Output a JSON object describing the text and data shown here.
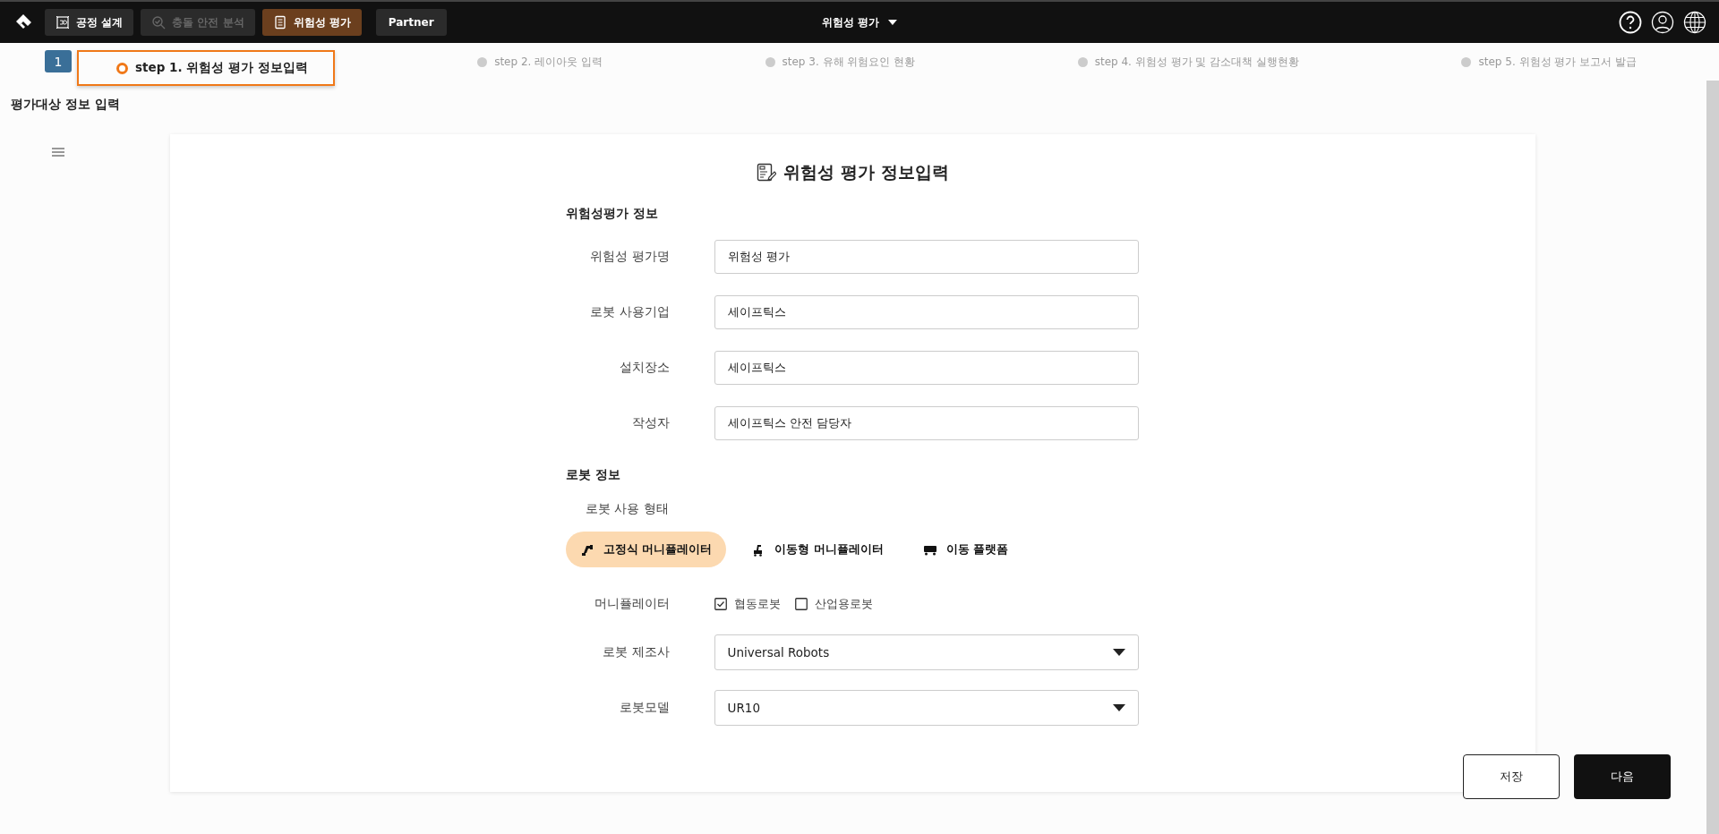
{
  "nav": {
    "tabs": [
      {
        "label": "공정 설계",
        "kind": "cube",
        "selected": false,
        "disabled": false
      },
      {
        "label": "충돌 안전 분석",
        "kind": "search",
        "selected": false,
        "disabled": true
      },
      {
        "label": "위험성 평가",
        "kind": "doc",
        "selected": true,
        "disabled": false
      },
      {
        "label": "Partner",
        "selected": false,
        "disabled": false
      }
    ],
    "center_menu": "위험성 평가"
  },
  "steps": {
    "badge": "1",
    "items": [
      {
        "label": "step 1. 위험성 평가 정보입력",
        "selected": true
      },
      {
        "label": "step 2. 레이아웃 입력",
        "selected": false
      },
      {
        "label": "step 3. 유해 위험요인 현황",
        "selected": false
      },
      {
        "label": "step 4. 위험성 평가 및 감소대책 실행현황",
        "selected": false
      },
      {
        "label": "step 5. 위험성 평가 보고서 발급",
        "selected": false
      }
    ]
  },
  "page_title": "평가대상 정보 입력",
  "form": {
    "title": "위험성 평가 정보입력",
    "section_1": "위험성평가 정보",
    "fields": [
      {
        "label": "위험성 평가명",
        "value": "위험성 평가"
      },
      {
        "label": "로봇 사용기업",
        "value": "세이프틱스"
      },
      {
        "label": "설치장소",
        "value": "세이프틱스"
      },
      {
        "label": "작성자",
        "value": "세이프틱스 안전 담당자"
      }
    ],
    "section_2": "로봇 정보",
    "usage_label": "로봇 사용 형태",
    "usage_types": [
      {
        "label": "고정식 머니퓰레이터",
        "kind": "arm",
        "selected": true
      },
      {
        "label": "이동형 머니퓰레이터",
        "kind": "mobile-arm",
        "selected": false
      },
      {
        "label": "이동 플랫폼",
        "kind": "cart",
        "selected": false
      }
    ],
    "manipulator": {
      "label": "머니퓰레이터",
      "options": [
        {
          "label": "협동로봇",
          "checked": true
        },
        {
          "label": "산업용로봇",
          "checked": false
        }
      ]
    },
    "selects": [
      {
        "label": "로봇 제조사",
        "value": "Universal Robots"
      },
      {
        "label": "로봇모델",
        "value": "UR10"
      }
    ]
  },
  "buttons": {
    "save": "저장",
    "next": "다음"
  }
}
